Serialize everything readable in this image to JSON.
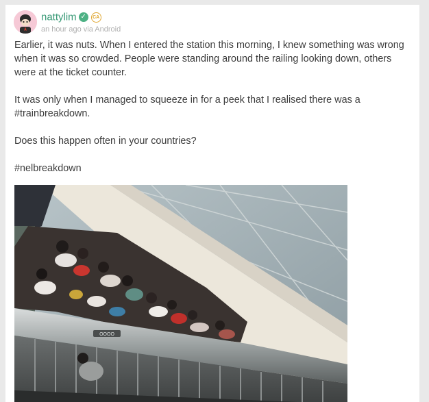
{
  "post": {
    "author": {
      "username": "nattylim",
      "badge_text": "CA",
      "verified_glyph": "✓"
    },
    "meta": "an hour ago via Android",
    "paragraphs": [
      "Earlier, it was nuts. When I entered the station this morning, I knew something was wrong when it was so crowded. People were standing around the railing looking down, others were at the ticket counter.",
      "It was only when I managed to squeeze in for a peek that I realised there was a #trainbreakdown.",
      "Does this happen often in your countries?",
      "#nelbreakdown"
    ]
  },
  "icons": {
    "verified": "verified-check-icon",
    "badge": "circle-badge-icon"
  },
  "colors": {
    "username": "#3a9a77",
    "verified_bg": "#4db184",
    "badge": "#e0a732",
    "meta": "#b0b0b0",
    "body_text": "#3b3b3b",
    "page_bg": "#e9e9e9",
    "card_bg": "#ffffff"
  }
}
